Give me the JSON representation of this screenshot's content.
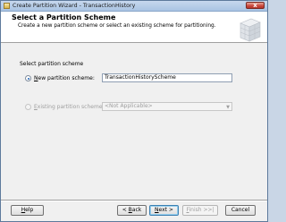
{
  "window": {
    "title": "Create Partition Wizard - TransactionHistory",
    "close_label": "x"
  },
  "header": {
    "title": "Select a Partition Scheme",
    "description": "Create a new partition scheme or select an existing scheme for partitioning."
  },
  "section_label": "Select partition scheme",
  "options": {
    "new_scheme": {
      "label_key": "N",
      "label_rest": "ew partition scheme:",
      "value": "TransactionHistoryScheme",
      "selected": true
    },
    "existing_scheme": {
      "label_key": "E",
      "label_rest": "xisting partition scheme:",
      "value": "<Not Applicable>",
      "enabled": false,
      "dropdown_icon": "chevron-down-icon"
    }
  },
  "buttons": {
    "help": {
      "key": "H",
      "rest": "elp"
    },
    "back": {
      "arrow": "< ",
      "key": "B",
      "rest": "ack"
    },
    "next": {
      "key": "N",
      "rest": "ext >"
    },
    "finish": {
      "key": "F",
      "rest": "inish >>|"
    },
    "cancel": {
      "label": "Cancel"
    }
  }
}
